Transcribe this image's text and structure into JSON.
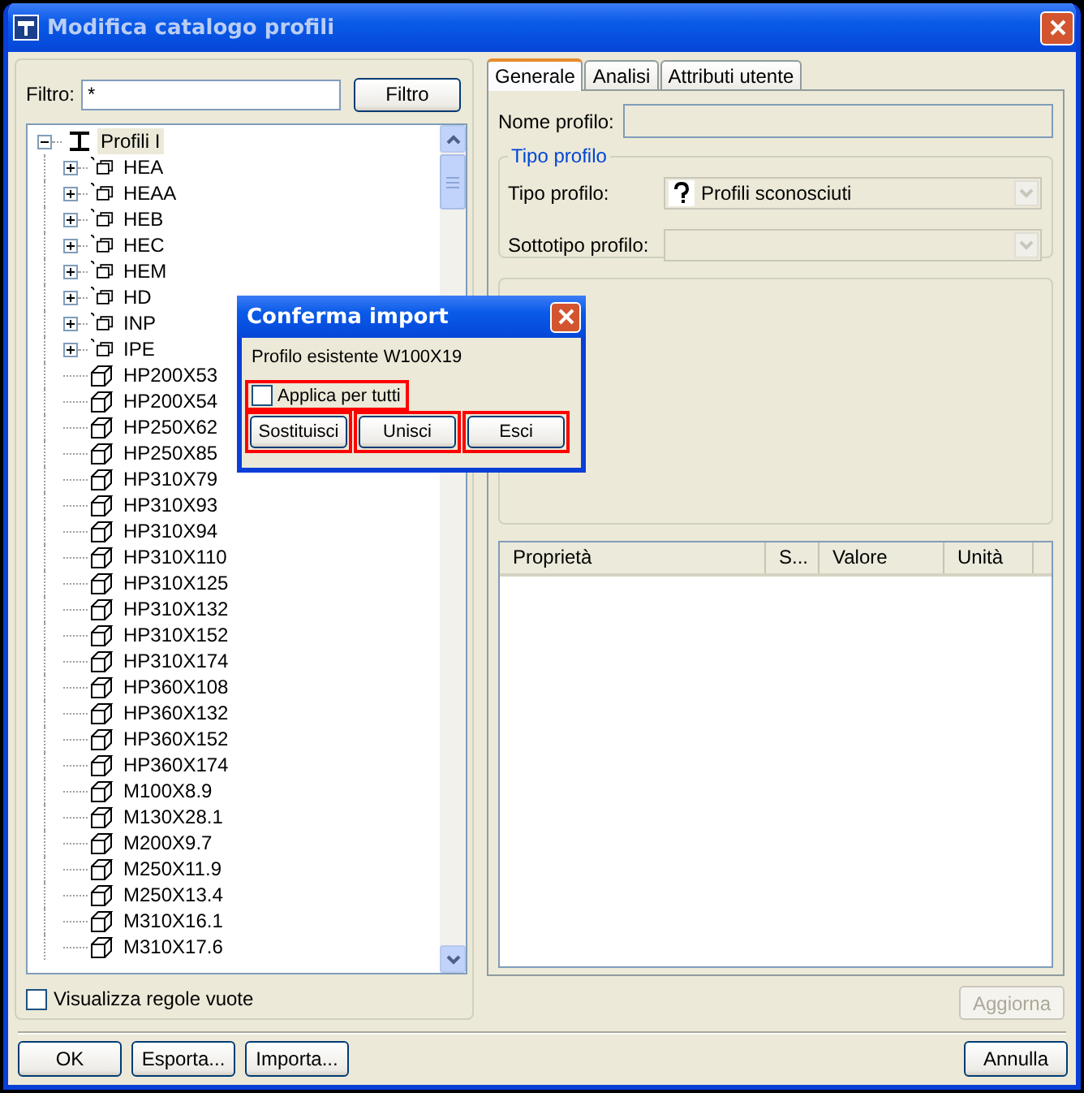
{
  "window": {
    "title": "Modifica catalogo profili"
  },
  "filter": {
    "label": "Filtro:",
    "value": "*",
    "button": "Filtro"
  },
  "tree": {
    "label": "Profili I",
    "kind": "root",
    "expanded": true,
    "selected": true,
    "children": [
      {
        "label": "HEA",
        "kind": "family",
        "expanded": false
      },
      {
        "label": "HEAA",
        "kind": "family",
        "expanded": false
      },
      {
        "label": "HEB",
        "kind": "family",
        "expanded": false
      },
      {
        "label": "HEC",
        "kind": "family",
        "expanded": false
      },
      {
        "label": "HEM",
        "kind": "family",
        "expanded": false
      },
      {
        "label": "HD",
        "kind": "family",
        "expanded": false
      },
      {
        "label": "INP",
        "kind": "family",
        "expanded": false
      },
      {
        "label": "IPE",
        "kind": "family",
        "expanded": false
      },
      {
        "label": "HP200X53",
        "kind": "profile"
      },
      {
        "label": "HP200X54",
        "kind": "profile"
      },
      {
        "label": "HP250X62",
        "kind": "profile"
      },
      {
        "label": "HP250X85",
        "kind": "profile"
      },
      {
        "label": "HP310X79",
        "kind": "profile"
      },
      {
        "label": "HP310X93",
        "kind": "profile"
      },
      {
        "label": "HP310X94",
        "kind": "profile"
      },
      {
        "label": "HP310X110",
        "kind": "profile"
      },
      {
        "label": "HP310X125",
        "kind": "profile"
      },
      {
        "label": "HP310X132",
        "kind": "profile"
      },
      {
        "label": "HP310X152",
        "kind": "profile"
      },
      {
        "label": "HP310X174",
        "kind": "profile"
      },
      {
        "label": "HP360X108",
        "kind": "profile"
      },
      {
        "label": "HP360X132",
        "kind": "profile"
      },
      {
        "label": "HP360X152",
        "kind": "profile"
      },
      {
        "label": "HP360X174",
        "kind": "profile"
      },
      {
        "label": "M100X8.9",
        "kind": "profile"
      },
      {
        "label": "M130X28.1",
        "kind": "profile"
      },
      {
        "label": "M200X9.7",
        "kind": "profile"
      },
      {
        "label": "M250X11.9",
        "kind": "profile"
      },
      {
        "label": "M250X13.4",
        "kind": "profile"
      },
      {
        "label": "M310X16.1",
        "kind": "profile"
      },
      {
        "label": "M310X17.6",
        "kind": "profile"
      }
    ]
  },
  "show_empty": {
    "label": "Visualizza regole vuote",
    "checked": false
  },
  "tabs": [
    {
      "label": "Generale",
      "selected": true
    },
    {
      "label": "Analisi",
      "selected": false
    },
    {
      "label": "Attributi utente",
      "selected": false
    }
  ],
  "name_field": {
    "label": "Nome profilo:",
    "disabled": true
  },
  "type_group": {
    "title": "Tipo profilo",
    "type": {
      "label": "Tipo profilo:",
      "value": "Profili sconosciuti",
      "disabled": true
    },
    "subtype": {
      "label": "Sottotipo profilo:",
      "disabled": true
    }
  },
  "properties": {
    "columns": [
      "Proprietà",
      "S...",
      "Valore",
      "Unità"
    ]
  },
  "update_button": {
    "label": "Aggiorna",
    "disabled": true
  },
  "buttons": [
    {
      "label": "OK"
    },
    {
      "label": "Esporta..."
    },
    {
      "label": "Importa..."
    },
    {
      "label": "Annulla"
    }
  ],
  "dialog": {
    "title": "Conferma import",
    "message": "Profilo esistente W100X19",
    "apply_all": {
      "label": "Applica per tutti",
      "checked": false,
      "highlighted": true
    },
    "buttons": [
      {
        "label": "Sostituisci",
        "highlighted": true
      },
      {
        "label": "Unisci",
        "highlighted": true
      },
      {
        "label": "Esci",
        "highlighted": true
      }
    ]
  }
}
